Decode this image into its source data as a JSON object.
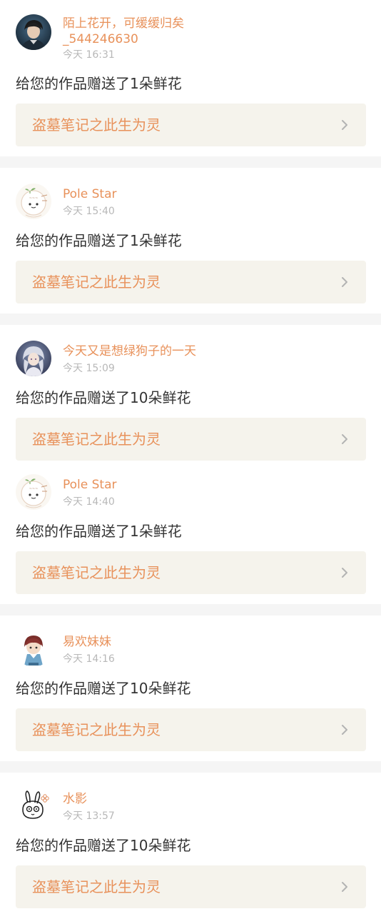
{
  "colors": {
    "accent": "#e8915a",
    "text": "#333333",
    "muted": "#b8b8b8",
    "card_bg": "#f5f3ec",
    "divider_bg": "#f5f5f5"
  },
  "notifications": [
    {
      "username": "陌上花开，可缓缓归矣_544246630",
      "time": "今天 16:31",
      "message": "给您的作品赠送了1朵鲜花",
      "work_title": "盗墓笔记之此生为灵",
      "avatar_icon": "dark-portrait-avatar-icon"
    },
    {
      "username": "Pole Star",
      "time": "今天 15:40",
      "message": "给您的作品赠送了1朵鲜花",
      "work_title": "盗墓笔记之此生为灵",
      "avatar_icon": "cartoon-sprout-avatar-icon"
    },
    {
      "username": "今天又是想绿狗子的一天",
      "time": "今天 15:09",
      "message": "给您的作品赠送了10朵鲜花",
      "work_title": "盗墓笔记之此生为灵",
      "avatar_icon": "anime-character-avatar-icon"
    },
    {
      "username": "Pole Star",
      "time": "今天 14:40",
      "message": "给您的作品赠送了1朵鲜花",
      "work_title": "盗墓笔记之此生为灵",
      "avatar_icon": "cartoon-sprout-avatar-icon"
    },
    {
      "username": "易欢妹妹",
      "time": "今天 14:16",
      "message": "给您的作品赠送了10朵鲜花",
      "work_title": "盗墓笔记之此生为灵",
      "avatar_icon": "chibi-child-avatar-icon"
    },
    {
      "username": "水影",
      "time": "今天 13:57",
      "message": "给您的作品赠送了10朵鲜花",
      "work_title": "盗墓笔记之此生为灵",
      "avatar_icon": "sketch-bunny-avatar-icon"
    }
  ]
}
